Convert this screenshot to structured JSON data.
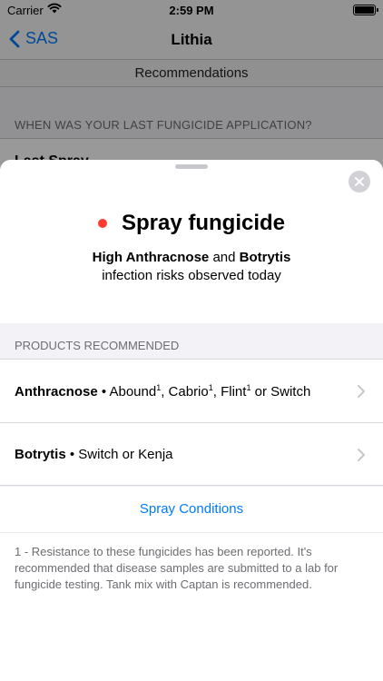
{
  "status_bar": {
    "carrier": "Carrier",
    "time": "2:59 PM"
  },
  "nav": {
    "back_label": "SAS",
    "title": "Lithia"
  },
  "segment": {
    "label": "Recommendations"
  },
  "background": {
    "section_header": "WHEN WAS YOUR LAST FUNGICIDE APPLICATION?",
    "row_label": "Last Spray"
  },
  "sheet": {
    "headline": "Spray fungicide",
    "status_color": "#ff3b30",
    "risk_a": "High Anthracnose",
    "risk_and": "and",
    "risk_b": "Botrytis",
    "risk_line2": "infection risks observed today",
    "products_header": "PRODUCTS RECOMMENDED",
    "products": [
      {
        "disease": "Anthracnose",
        "sep": "•",
        "p1": "Abound",
        "p1_sup": "1",
        "comma1": ",",
        "p2": "Cabrio",
        "p2_sup": "1",
        "comma2": ",",
        "p3": "Flint",
        "p3_sup": "1",
        "rest": "or Switch"
      },
      {
        "disease": "Botrytis",
        "sep": "•",
        "rest": "Switch or Kenja"
      }
    ],
    "spray_conditions": "Spray Conditions",
    "footnote": "1 - Resistance to these fungicides has been reported. It's recommended that disease samples are submitted to a lab for fungicide testing. Tank mix with Captan is recommended."
  },
  "icons": {
    "back": "chevron-left-icon",
    "close": "close-icon",
    "chevron": "chevron-right-icon",
    "wifi": "wifi-icon",
    "battery": "battery-icon"
  },
  "colors": {
    "accent": "#007aff",
    "alert": "#ff3b30"
  }
}
